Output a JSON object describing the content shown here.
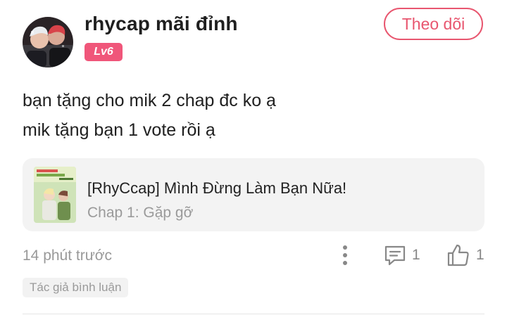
{
  "comment": {
    "user": {
      "name": "rhycap mãi đỉnh",
      "level": "Lv6",
      "avatar_icon": "avatar-photo"
    },
    "follow_label": "Theo dõi",
    "text_lines": [
      "bạn tặng cho mik 2 chap đc ko ạ",
      "mik tặng bạn 1 vote rồi ạ"
    ],
    "chapter": {
      "title": "[RhyCcap] Mình Đừng Làm Bạn Nữa!",
      "subtitle": "Chap 1: Gặp gỡ",
      "thumb_icon": "comic-cover-thumbnail"
    },
    "time": "14 phút trước",
    "reply_count": "1",
    "like_count": "1",
    "tag": "Tác giả bình luận",
    "colors": {
      "accent": "#e8566f",
      "badge": "#f0567a",
      "muted": "#999999",
      "card_bg": "#f3f3f3"
    }
  }
}
